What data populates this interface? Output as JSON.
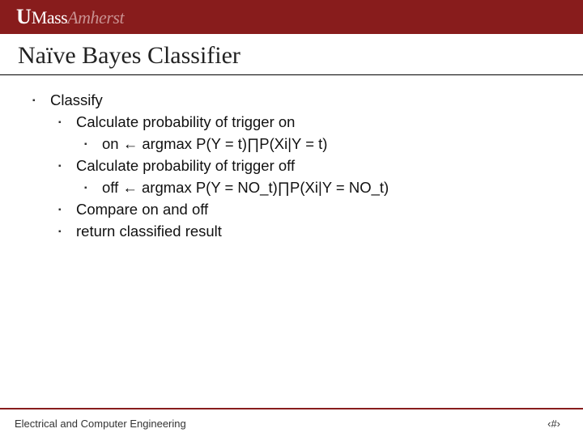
{
  "header": {
    "logo_u": "U",
    "logo_mass": "Mass",
    "logo_amherst": "Amherst"
  },
  "title": "Naïve Bayes Classifier",
  "bullets": {
    "b1": "Classify",
    "b2": "Calculate probability of trigger on",
    "b3": "on ← argmax P(Y = t)∏P(Xi|Y = t)",
    "b4": "Calculate probability of trigger off",
    "b5": "off ← argmax P(Y = NO_t)∏P(Xi|Y = NO_t)",
    "b6": "Compare on and off",
    "b7": "return classified result"
  },
  "footer": {
    "dept": "Electrical and Computer Engineering",
    "page": "‹#›"
  }
}
